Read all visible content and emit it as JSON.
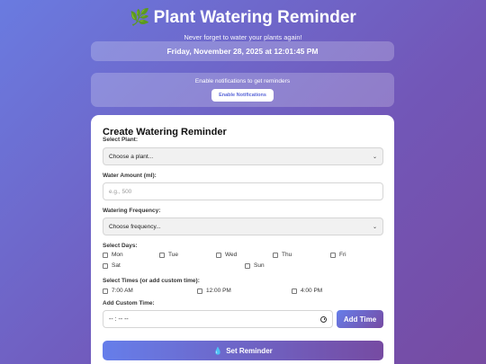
{
  "header": {
    "title": "Plant Watering Reminder",
    "title_icon": "🌿",
    "subtitle": "Never forget to water your plants again!"
  },
  "datetime": "Friday, November 28, 2025 at 12:01:45 PM",
  "notifications": {
    "text": "Enable notifications to get reminders",
    "button_label": "Enable Notifications"
  },
  "form": {
    "heading": "Create Watering Reminder",
    "plant_label": "Select Plant:",
    "plant_value": "Choose a plant...",
    "water_label": "Water Amount (ml):",
    "water_placeholder": "e.g., 500",
    "frequency_label": "Watering Frequency:",
    "frequency_value": "Choose frequency...",
    "days_label": "Select Days:",
    "days": [
      "Mon",
      "Tue",
      "Wed",
      "Thu",
      "Fri",
      "Sat",
      "Sun"
    ],
    "times_label": "Select Times (or add custom time):",
    "times": [
      "7:00 AM",
      "12:00 PM",
      "4:00 PM"
    ],
    "custom_time_label": "Add Custom Time:",
    "custom_time_value": "-- : --  --",
    "add_time_label": "Add Time",
    "submit_label": "Set Reminder",
    "submit_icon": "💧"
  }
}
